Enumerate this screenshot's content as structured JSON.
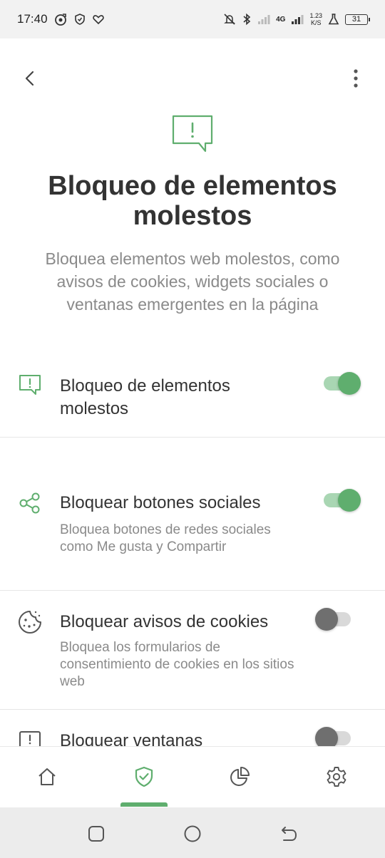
{
  "status_bar": {
    "time": "17:40",
    "network": "4G",
    "speed_value": "1.23",
    "speed_unit": "K/S",
    "battery": "31"
  },
  "header": {
    "title": "Bloqueo de elementos molestos",
    "subtitle": "Bloquea elementos web molestos, como avisos de cookies, widgets sociales o ventanas emergentes en la página"
  },
  "settings": [
    {
      "icon": "alert-message-icon",
      "title": "Bloqueo de elementos molestos",
      "description": "",
      "enabled": true
    },
    {
      "icon": "share-icon",
      "title": "Bloquear botones sociales",
      "description": "Bloquea botones de redes sociales como Me gusta y Compartir",
      "enabled": true
    },
    {
      "icon": "cookie-icon",
      "title": "Bloquear avisos de cookies",
      "description": "Bloquea los formularios de consentimiento de cookies en los sitios web",
      "enabled": false
    },
    {
      "icon": "popup-alert-icon",
      "title": "Bloquear ventanas",
      "description": "",
      "enabled": false
    }
  ],
  "bottom_nav": {
    "items": [
      "home-icon",
      "shield-check-icon",
      "pie-chart-icon",
      "gear-icon"
    ],
    "active_index": 1
  },
  "colors": {
    "accent": "#5fae6e",
    "accent_light": "#a9d6b3",
    "text_primary": "#333333",
    "text_secondary": "#8a8a8a"
  }
}
